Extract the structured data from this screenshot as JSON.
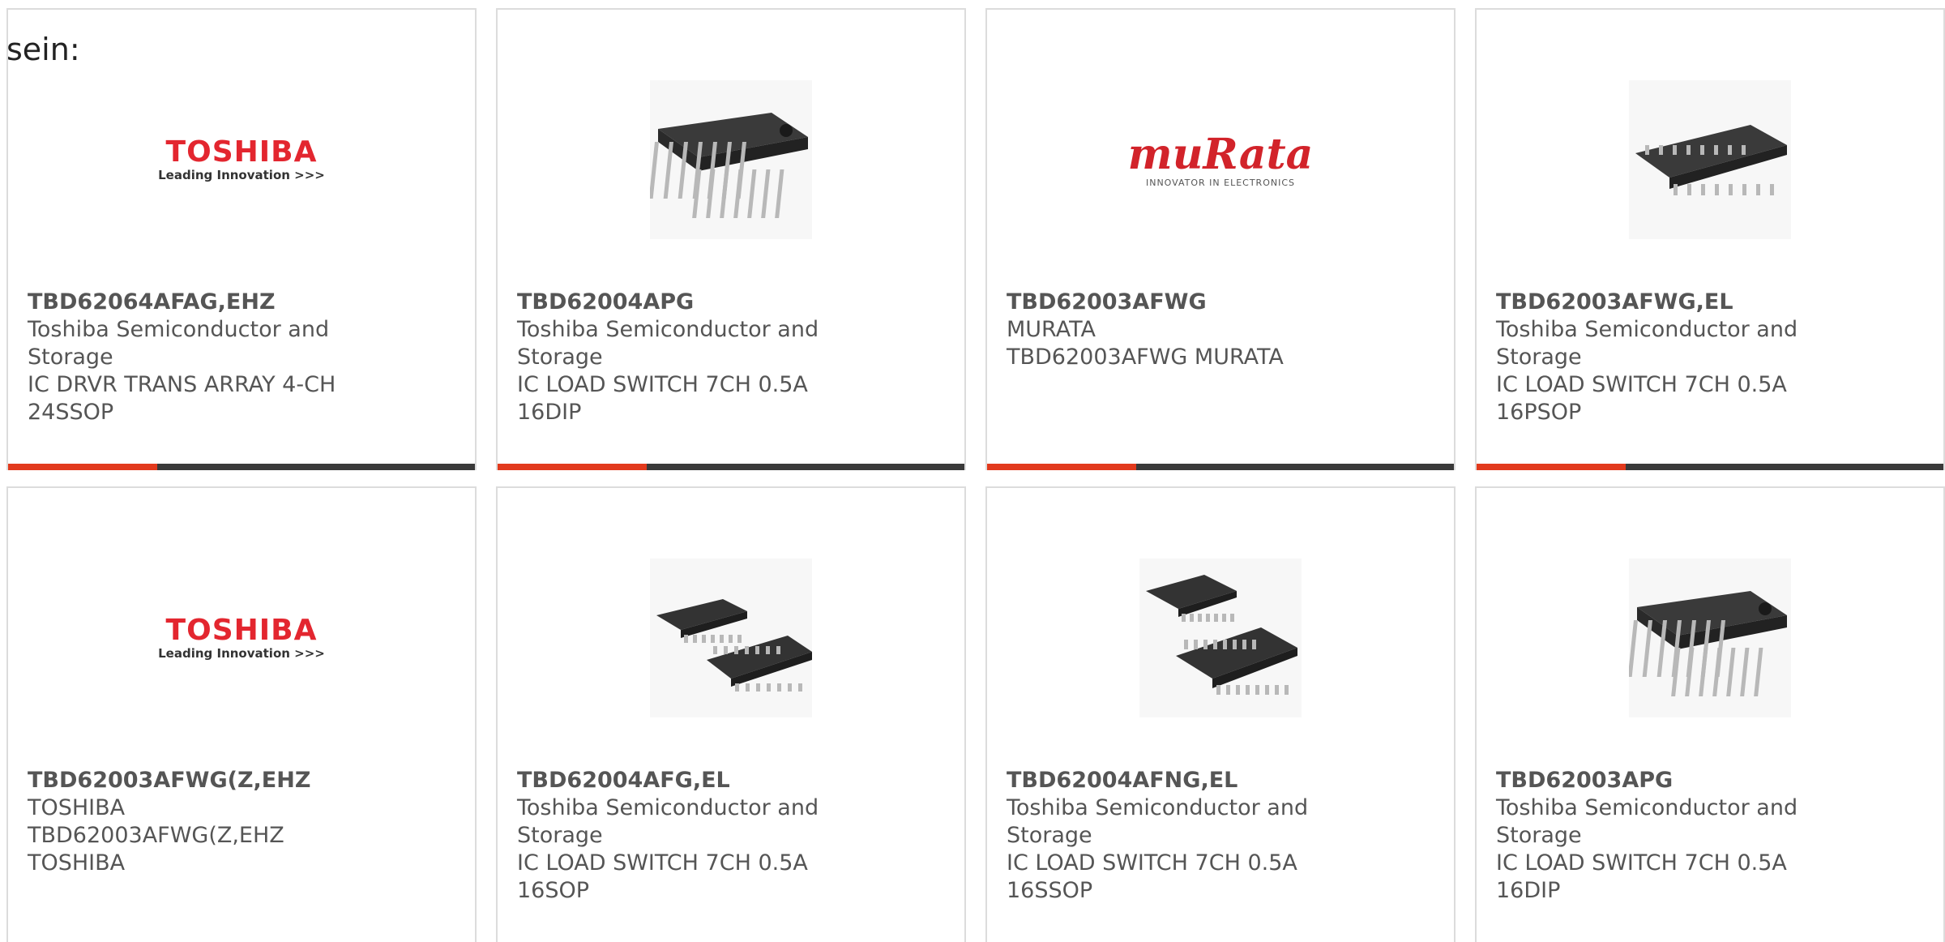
{
  "intro_text": "sein:",
  "products": [
    {
      "part_number": "TBD62064AFAG,EHZ",
      "manufacturer": "Toshiba Semiconductor and Storage",
      "description": "IC DRVR TRANS ARRAY 4-CH 24SSOP",
      "image": "toshiba-logo",
      "logo_brand": "TOSHIBA",
      "logo_tag": "Leading Innovation >>>"
    },
    {
      "part_number": "TBD62004APG",
      "manufacturer": "Toshiba Semiconductor and Storage",
      "description": "IC LOAD SWITCH 7CH 0.5A 16DIP",
      "image": "dip16-chip"
    },
    {
      "part_number": "TBD62003AFWG",
      "manufacturer": "MURATA",
      "description": "TBD62003AFWG MURATA",
      "image": "murata-logo",
      "logo_brand": "muRata",
      "logo_tag": "INNOVATOR IN ELECTRONICS"
    },
    {
      "part_number": "TBD62003AFWG,EL",
      "manufacturer": "Toshiba Semiconductor and Storage",
      "description": "IC LOAD SWITCH 7CH 0.5A 16PSOP",
      "image": "sop16-chip"
    },
    {
      "part_number": "TBD62003AFWG(Z,EHZ",
      "manufacturer": "TOSHIBA",
      "description": "TBD62003AFWG(Z,EHZ TOSHIBA",
      "image": "toshiba-logo",
      "logo_brand": "TOSHIBA",
      "logo_tag": "Leading Innovation >>>"
    },
    {
      "part_number": "TBD62004AFG,EL",
      "manufacturer": "Toshiba Semiconductor and Storage",
      "description": "IC LOAD SWITCH 7CH 0.5A 16SOP",
      "image": "sop-pair-chip"
    },
    {
      "part_number": "TBD62004AFNG,EL",
      "manufacturer": "Toshiba Semiconductor and Storage",
      "description": "IC LOAD SWITCH 7CH 0.5A 16SSOP",
      "image": "ssop-pair-chip"
    },
    {
      "part_number": "TBD62003APG",
      "manufacturer": "Toshiba Semiconductor and Storage",
      "description": "IC LOAD SWITCH 7CH 0.5A 16DIP",
      "image": "dip16-chip"
    }
  ],
  "colors": {
    "accent": "#e23a1d",
    "bar_dark": "#3a3a3a",
    "text": "#555555",
    "toshiba_red": "#e3262f",
    "murata_red": "#d2232a"
  }
}
